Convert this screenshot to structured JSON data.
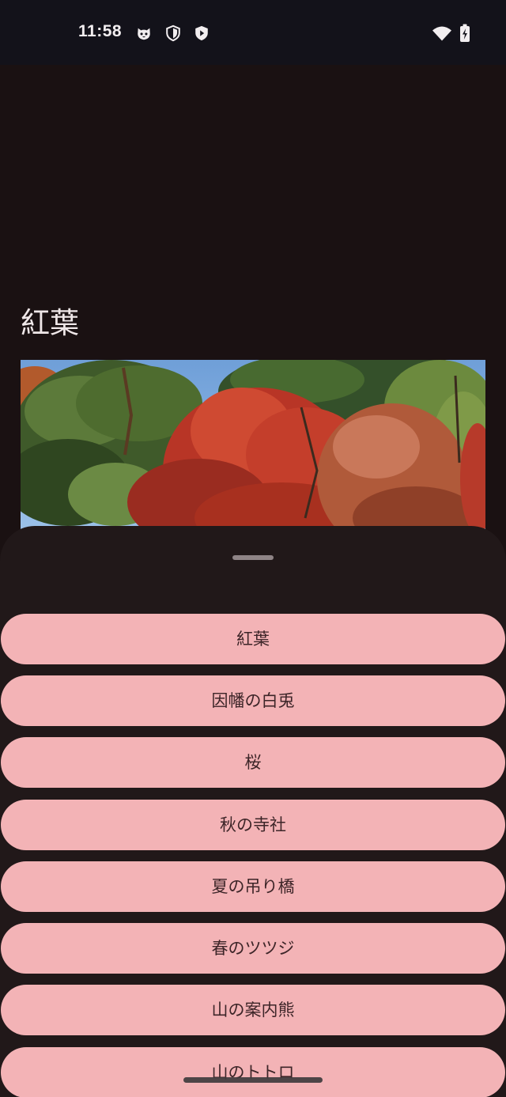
{
  "status_bar": {
    "time": "11:58",
    "notification_icons": [
      "cat-face-icon",
      "shield-icon",
      "play-shield-icon"
    ],
    "system_icons": [
      "wifi-icon",
      "battery-charging-icon"
    ]
  },
  "page": {
    "title": "紅葉",
    "image": "autumn-foliage-photo"
  },
  "sheet": {
    "options": [
      "紅葉",
      "因幡の白兎",
      "桜",
      "秋の寺社",
      "夏の吊り橋",
      "春のツツジ",
      "山の案内熊",
      "山のトトロ"
    ]
  },
  "colors": {
    "background": "#1a1112",
    "sheet": "#211819",
    "button": "#f3b3b6",
    "button_text": "#3d2528",
    "status_bar": "#13121a"
  }
}
